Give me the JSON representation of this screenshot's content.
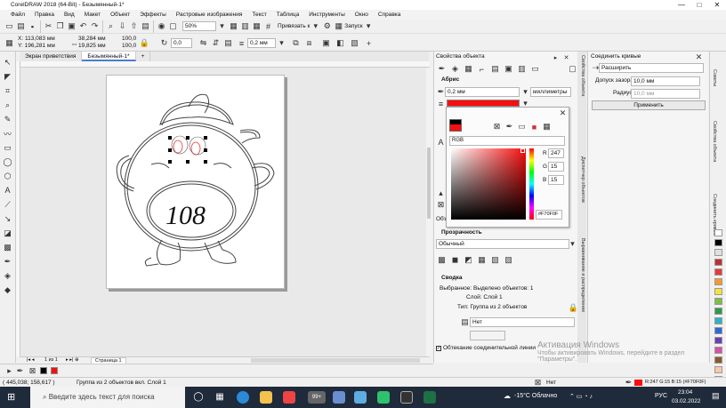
{
  "window": {
    "title": "CorelDRAW 2018 (64-Bit) - Безымянный-1*",
    "controls": [
      "—",
      "□",
      "✕"
    ]
  },
  "menu": [
    "Файл",
    "Правка",
    "Вид",
    "Макет",
    "Объект",
    "Эффекты",
    "Растровые изображения",
    "Текст",
    "Таблица",
    "Инструменты",
    "Окно",
    "Справка"
  ],
  "standard_toolbar": {
    "zoom": "50%",
    "snap_label": "Привязать к",
    "launch_label": "Запуск"
  },
  "property_bar": {
    "x": "X: 113,083 мм",
    "y": "Y: 196,281 мм",
    "width": "38,284 мм",
    "height": "19,825 мм",
    "scale_w": "100,0",
    "scale_h": "100,0",
    "rotation": "0,0",
    "outline": "0,2 мм"
  },
  "doc_tabs": [
    "Экран приветствия",
    "Безымянный-1*"
  ],
  "page_nav": {
    "counter": "1 из 1",
    "page_tab": "Страница 1"
  },
  "canvas": {
    "number_text": "108"
  },
  "object_properties": {
    "title": "Свойства объекта",
    "outline_header": "Абрис",
    "outline_width": "0,2 мм",
    "outline_units": "миллиметры",
    "fill_color": "#F70F0F",
    "model": "RGB",
    "r_label": "R",
    "r_value": "247",
    "g_label": "G",
    "g_value": "15",
    "b_label": "B",
    "b_value": "15",
    "hex": "#F70F0F",
    "fill_header": "Прозрачность",
    "obj_label": "Объ",
    "blend_mode": "Обычный",
    "summary_header": "Сводка",
    "selected_text": "Выбранное: Выделено объектов: 1",
    "layer_text": "Слой: Слой 1",
    "type_text": "Тип: Группа из 2 объектов",
    "wrap_value": "Нет",
    "connector_checkbox": "Обтекание соединительной линии"
  },
  "join_curves": {
    "title": "Соединить кривые",
    "mode": "Расширить",
    "gap_label": "Допуск зазора:",
    "gap_value": "10,0 мм",
    "radius_label": "Радиус:",
    "radius_value": "10,0 мм",
    "apply_label": "Применить"
  },
  "side_tabs": [
    "Соединить кривые",
    "Свойства объекта",
    "Диспетчер объектов",
    "Выравнивание и распределение"
  ],
  "right_tabs": [
    "Советы",
    "Свойства объекта",
    "Соединить кривые"
  ],
  "palette_colors": [
    "#ffffff",
    "#000000",
    "#e0e0e0",
    "#c03030",
    "#e83a3a",
    "#f29a2e",
    "#f5e23a",
    "#7cc043",
    "#2e9a4a",
    "#2ab3c8",
    "#2c6bd6",
    "#6a3fb3",
    "#d94fa8",
    "#8b5a2b",
    "#f6c9a8",
    "#bde3f5"
  ],
  "color_bar": {
    "outline_color": "#000000",
    "fill_color": "#F70F0F"
  },
  "status": {
    "coords": "( 445,038; 158,617 )",
    "selection": "Группа из 2 объектов вкл. Слой 1",
    "fill_label": "Нет",
    "color_info": "R:247 G:15 B:15 (#F70F0F)"
  },
  "watermark": {
    "line1": "Активация Windows",
    "line2": "Чтобы активировать Windows, перейдите в раздел",
    "line3": "\"Параметры\"."
  },
  "taskbar": {
    "search_placeholder": "Введите здесь текст для поиска",
    "weather": "-15°C Облачно",
    "lang": "РУС",
    "time": "23:04",
    "date": "03.02.2022",
    "badge": "99+"
  }
}
